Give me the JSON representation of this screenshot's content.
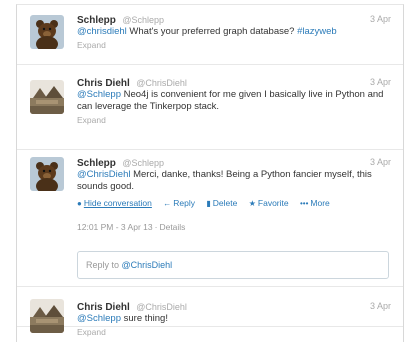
{
  "tweets": [
    {
      "fullname": "Schlepp",
      "username": "@Schlepp",
      "time": "3 Apr",
      "mention": "@chrisdiehl",
      "text": " What's your preferred graph database? ",
      "hashtag": "#lazyweb",
      "expand": "Expand",
      "avatar": "bear-avatar"
    },
    {
      "fullname": "Chris Diehl",
      "username": "@ChrisDiehl",
      "time": "3 Apr",
      "mention": "@Schlepp",
      "text": " Neo4j is convenient for me given I basically live in Python and can leverage the Tinkerpop stack.",
      "expand": "Expand",
      "avatar": "landscape-avatar"
    },
    {
      "fullname": "Schlepp",
      "username": "@Schlepp",
      "time": "3 Apr",
      "mention": "@ChrisDiehl",
      "text": " Merci, danke, thanks!  Being a Python fancier myself, this sounds good.",
      "avatar": "bear-avatar",
      "actions": {
        "hide": "Hide conversation",
        "reply": "Reply",
        "delete": "Delete",
        "favorite": "Favorite",
        "more": "More"
      },
      "meta_time": "12:01 PM - 3 Apr 13",
      "meta_sep": "·",
      "details": "Details",
      "reply_prefix": "Reply to ",
      "reply_mention": "@ChrisDiehl"
    },
    {
      "fullname": "Chris Diehl",
      "username": "@ChrisDiehl",
      "time": "3 Apr",
      "mention": "@Schlepp",
      "text": " sure thing!",
      "expand": "Expand",
      "avatar": "landscape-avatar"
    }
  ],
  "colors": {
    "link": "#2b7bb9",
    "muted": "#aaaaaa",
    "border": "#e8e8e8"
  }
}
